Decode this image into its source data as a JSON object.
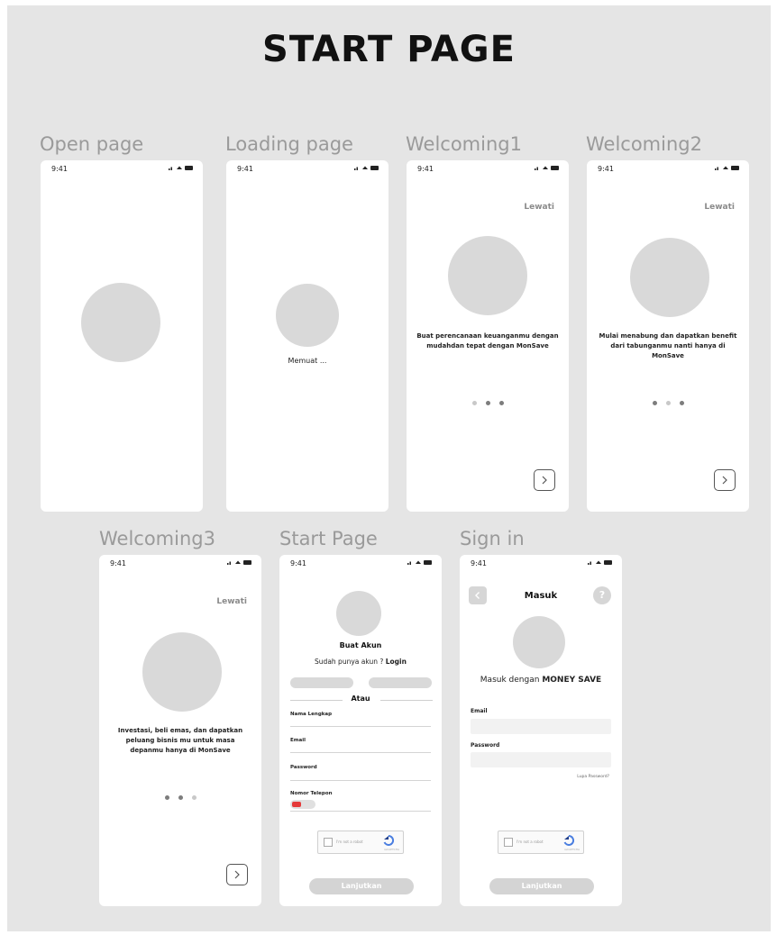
{
  "title": "START PAGE",
  "status_time": "9:41",
  "frames": {
    "open": {
      "label": "Open page"
    },
    "loading": {
      "label": "Loading page",
      "text": "Memuat ..."
    },
    "welcoming1": {
      "label": "Welcoming1",
      "skip": "Lewati",
      "text": "Buat perencanaan keuanganmu dengan mudahdan tepat dengan MonSave",
      "active_dot": 1
    },
    "welcoming2": {
      "label": "Welcoming2",
      "skip": "Lewati",
      "text": "Mulai menabung dan dapatkan benefit dari tabunganmu nanti hanya di MonSave",
      "active_dot": 1
    },
    "welcoming3": {
      "label": "Welcoming3",
      "skip": "Lewati",
      "text": "Investasi, beli emas, dan dapatkan peluang bisnis mu untuk masa depanmu hanya di MonSave",
      "active_dot": 1
    },
    "start": {
      "label": "Start Page",
      "heading": "Buat Akun",
      "login_prompt": "Sudah punya akun ?",
      "login_link": "Login",
      "divider": "Atau",
      "fields": [
        "Nama Lengkap",
        "Email",
        "Password",
        "Nomor Telepon"
      ],
      "captcha": "I'm not a robot",
      "captcha_sub": "reCAPTCHA",
      "button": "Lanjutkan"
    },
    "signin": {
      "label": "Sign in",
      "header": "Masuk",
      "help": "?",
      "subtitle_prefix": "Masuk dengan",
      "subtitle_brand": "MONEY SAVE",
      "email_label": "Email",
      "password_label": "Password",
      "forgot": "Lupa Password?",
      "captcha": "I'm not a robot",
      "captcha_sub": "reCAPTCHA",
      "button": "Lanjutkan"
    }
  },
  "colors": {
    "background": "#e5e5e5",
    "placeholder": "#d9d9d9",
    "label": "#9a9a9a"
  }
}
